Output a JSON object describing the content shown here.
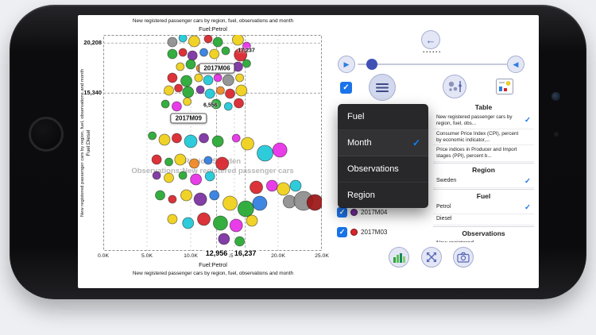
{
  "colors": {
    "accent": "#1a73e8",
    "dropdown_check": "#0a84ff",
    "slider_knob": "#3f51b5",
    "watermark": "#9a9a9a"
  },
  "icons": {
    "play": "▶",
    "prev": "◀",
    "back": "←",
    "check": "✓",
    "dots": "......"
  },
  "chart_data": {
    "type": "bubble",
    "title": "New registered passenger cars by region, fuel, observations and month",
    "subtitle": "Fuel:Petrol",
    "ylabel_title": "New registered passenger cars by region, fuel, observations and month",
    "ylabel": "Fuel:Diesel",
    "xlabel": "Fuel:Petrol",
    "bottom_title": "New registered passenger cars by region, fuel, observations and month",
    "watermark_line1": "Region:Sweden",
    "watermark_line2": "Observations:New registered passenger cars",
    "x_range_k": [
      0,
      25
    ],
    "y_range": [
      0,
      21000
    ],
    "x_ticks": [
      "0.0K",
      "5.0K",
      "10.0K",
      "15.0K",
      "20.0K",
      "25.0K"
    ],
    "y_ticks": [
      {
        "label": "20,208",
        "value": 20208
      },
      {
        "label": "15,340",
        "value": 15340
      }
    ],
    "x_highlights": [
      {
        "label": "12,956",
        "value_k": 12.956
      },
      {
        "label": "16,237",
        "value_k": 16.237
      }
    ],
    "annotations": [
      {
        "label": "2017M06",
        "fx": 0.52,
        "fy": 0.155,
        "value": "17,237",
        "vfx": 0.655,
        "vfy": 0.075
      },
      {
        "label": "2017M09",
        "fx": 0.39,
        "fy": 0.385,
        "value": "6,556",
        "vfx": 0.49,
        "vfy": 0.327
      }
    ],
    "bubbles": [
      [
        7.9,
        20305,
        6,
        "#8e8e8e"
      ],
      [
        9.1,
        20691,
        5,
        "#1ec8d8"
      ],
      [
        10.4,
        20382,
        7,
        "#f0d018"
      ],
      [
        12.0,
        20614,
        5,
        "#d8242a"
      ],
      [
        13.1,
        20305,
        6,
        "#26a832"
      ],
      [
        15.4,
        20537,
        7,
        "#f0d018"
      ],
      [
        16.4,
        19919,
        5,
        "#e62ee6"
      ],
      [
        7.9,
        19147,
        6,
        "#26a832"
      ],
      [
        9.1,
        19301,
        5,
        "#d8242a"
      ],
      [
        10.2,
        18993,
        6,
        "#7b2fa0"
      ],
      [
        11.5,
        19301,
        5,
        "#2f7de0"
      ],
      [
        12.7,
        19147,
        6,
        "#f0d018"
      ],
      [
        14.0,
        19456,
        5,
        "#26a832"
      ],
      [
        15.7,
        19070,
        8,
        "#d8242a"
      ],
      [
        8.8,
        17912,
        5,
        "#f0d018"
      ],
      [
        10.0,
        18144,
        6,
        "#26a832"
      ],
      [
        11.1,
        17758,
        5,
        "#f08820"
      ],
      [
        15.4,
        17912,
        6,
        "#7b2fa0"
      ],
      [
        16.4,
        18221,
        5,
        "#26a832"
      ],
      [
        7.9,
        16831,
        6,
        "#d8242a"
      ],
      [
        9.5,
        16522,
        7,
        "#26a832"
      ],
      [
        10.9,
        16831,
        5,
        "#f0d018"
      ],
      [
        12.0,
        16600,
        6,
        "#1ec8d8"
      ],
      [
        13.1,
        16831,
        5,
        "#e62ee6"
      ],
      [
        14.3,
        16600,
        7,
        "#8e8e8e"
      ],
      [
        15.6,
        16831,
        5,
        "#f0d018"
      ],
      [
        7.5,
        15596,
        6,
        "#f0d018"
      ],
      [
        8.6,
        15828,
        5,
        "#d8242a"
      ],
      [
        9.7,
        15442,
        7,
        "#26a832"
      ],
      [
        11.1,
        15673,
        5,
        "#7b2fa0"
      ],
      [
        12.2,
        15287,
        6,
        "#1ec8d8"
      ],
      [
        13.4,
        15596,
        5,
        "#f08820"
      ],
      [
        14.5,
        15287,
        6,
        "#d8242a"
      ],
      [
        15.8,
        15596,
        7,
        "#f0d018"
      ],
      [
        7.1,
        14283,
        5,
        "#26a832"
      ],
      [
        8.4,
        14051,
        6,
        "#e62ee6"
      ],
      [
        9.6,
        14515,
        5,
        "#f0d018"
      ],
      [
        12.9,
        14283,
        6,
        "#26a832"
      ],
      [
        14.3,
        14051,
        5,
        "#1ec8d8"
      ],
      [
        15.5,
        14360,
        6,
        "#d8242a"
      ],
      [
        5.6,
        11194,
        5,
        "#26a832"
      ],
      [
        7.0,
        10808,
        7,
        "#f0d018"
      ],
      [
        8.4,
        10962,
        6,
        "#d8242a"
      ],
      [
        10.0,
        10654,
        8,
        "#1ec8d8"
      ],
      [
        11.5,
        10962,
        6,
        "#7b2fa0"
      ],
      [
        13.1,
        10654,
        7,
        "#26a832"
      ],
      [
        15.2,
        10962,
        5,
        "#e62ee6"
      ],
      [
        16.5,
        10422,
        8,
        "#f0d018"
      ],
      [
        18.5,
        9496,
        10,
        "#1ec8d8"
      ],
      [
        20.2,
        9804,
        9,
        "#e62ee6"
      ],
      [
        6.1,
        8878,
        6,
        "#d8242a"
      ],
      [
        7.5,
        8647,
        5,
        "#26a832"
      ],
      [
        8.8,
        8878,
        7,
        "#f0d018"
      ],
      [
        10.4,
        8492,
        6,
        "#f08820"
      ],
      [
        12.0,
        8801,
        5,
        "#2f7de0"
      ],
      [
        13.6,
        8492,
        8,
        "#d8242a"
      ],
      [
        6.1,
        7334,
        5,
        "#7b2fa0"
      ],
      [
        7.5,
        7103,
        6,
        "#f0d018"
      ],
      [
        9.1,
        7334,
        5,
        "#26a832"
      ],
      [
        10.6,
        6948,
        7,
        "#e62ee6"
      ],
      [
        12.2,
        7257,
        6,
        "#1ec8d8"
      ],
      [
        17.5,
        6177,
        8,
        "#d8242a"
      ],
      [
        19.3,
        6331,
        7,
        "#e62ee6"
      ],
      [
        20.6,
        6022,
        8,
        "#f0d018"
      ],
      [
        22.0,
        6331,
        7,
        "#1ec8d8"
      ],
      [
        6.5,
        5405,
        6,
        "#26a832"
      ],
      [
        7.9,
        5019,
        5,
        "#d8242a"
      ],
      [
        9.5,
        5405,
        7,
        "#f0d018"
      ],
      [
        11.1,
        5019,
        8,
        "#7b2fa0"
      ],
      [
        12.7,
        5405,
        6,
        "#2f7de0"
      ],
      [
        14.5,
        4633,
        9,
        "#f0d018"
      ],
      [
        16.3,
        4092,
        10,
        "#26a832"
      ],
      [
        17.9,
        4633,
        9,
        "#2f7de0"
      ],
      [
        21.3,
        4787,
        8,
        "#8e8e8e"
      ],
      [
        22.9,
        4865,
        12,
        "#8e8e8e"
      ],
      [
        24.2,
        4710,
        10,
        "#9b1616"
      ],
      [
        7.9,
        3089,
        6,
        "#f0d018"
      ],
      [
        9.7,
        2703,
        7,
        "#1ec8d8"
      ],
      [
        11.5,
        3089,
        8,
        "#d8242a"
      ],
      [
        13.4,
        2703,
        9,
        "#26a832"
      ],
      [
        15.2,
        2471,
        8,
        "#e62ee6"
      ],
      [
        17.0,
        2934,
        7,
        "#f0d018"
      ],
      [
        13.8,
        1158,
        7,
        "#7b2fa0"
      ],
      [
        15.6,
        926,
        6,
        "#26a832"
      ]
    ]
  },
  "legend": {
    "items": [
      {
        "label": "2017M04",
        "color": "#7b2fa0",
        "checked": true
      },
      {
        "label": "2017M03",
        "color": "#d8242a",
        "checked": true
      }
    ]
  },
  "dropdown": {
    "items": [
      {
        "label": "Fuel",
        "checked": false
      },
      {
        "label": "Month",
        "checked": true
      },
      {
        "label": "Observations",
        "checked": false
      },
      {
        "label": "Region",
        "checked": false
      }
    ]
  },
  "panel": {
    "sections": [
      {
        "header": "Table",
        "items": [
          {
            "label": "New registered passenger cars by region, fuel, obs...",
            "checked": true,
            "two": true
          },
          {
            "label": "Consumer Price Index (CPI), percent by economic indicator,...",
            "checked": false,
            "two": true
          },
          {
            "label": "Price indices in Producer and Import stages (PPI), percent b...",
            "checked": false,
            "two": true
          }
        ]
      },
      {
        "header": "Region",
        "items": [
          {
            "label": "Sweden",
            "checked": true
          }
        ]
      },
      {
        "header": "Fuel",
        "items": [
          {
            "label": "Petrol",
            "checked": true
          },
          {
            "label": "Diesel",
            "checked": false
          }
        ]
      },
      {
        "header": "Observations",
        "items": [
          {
            "label": "New registered...",
            "checked": false
          }
        ]
      }
    ]
  }
}
